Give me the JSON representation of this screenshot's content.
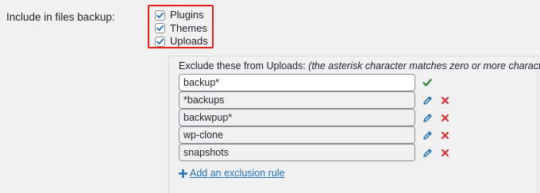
{
  "setting": {
    "label": "Include in files backup:"
  },
  "checkboxes": [
    {
      "label": "Plugins",
      "checked": true
    },
    {
      "label": "Themes",
      "checked": true
    },
    {
      "label": "Uploads",
      "checked": true
    }
  ],
  "exclusions": {
    "heading": "Exclude these from Uploads:",
    "note": "(the asterisk character matches zero or more characters)",
    "rules": [
      {
        "value": "backup*",
        "state": "editing"
      },
      {
        "value": "*backups",
        "state": "saved"
      },
      {
        "value": "backwpup*",
        "state": "saved"
      },
      {
        "value": "wp-clone",
        "state": "saved"
      },
      {
        "value": "snapshots",
        "state": "saved"
      }
    ],
    "add_label": "Add an exclusion rule"
  },
  "colors": {
    "highlight_border": "#e0241c",
    "link": "#2271b1",
    "confirm": "#2e7d32",
    "delete": "#d63638",
    "edit": "#2271b1"
  },
  "icons": {
    "confirm": "check-icon",
    "edit": "pencil-icon",
    "delete": "close-icon",
    "add": "plus-icon"
  }
}
